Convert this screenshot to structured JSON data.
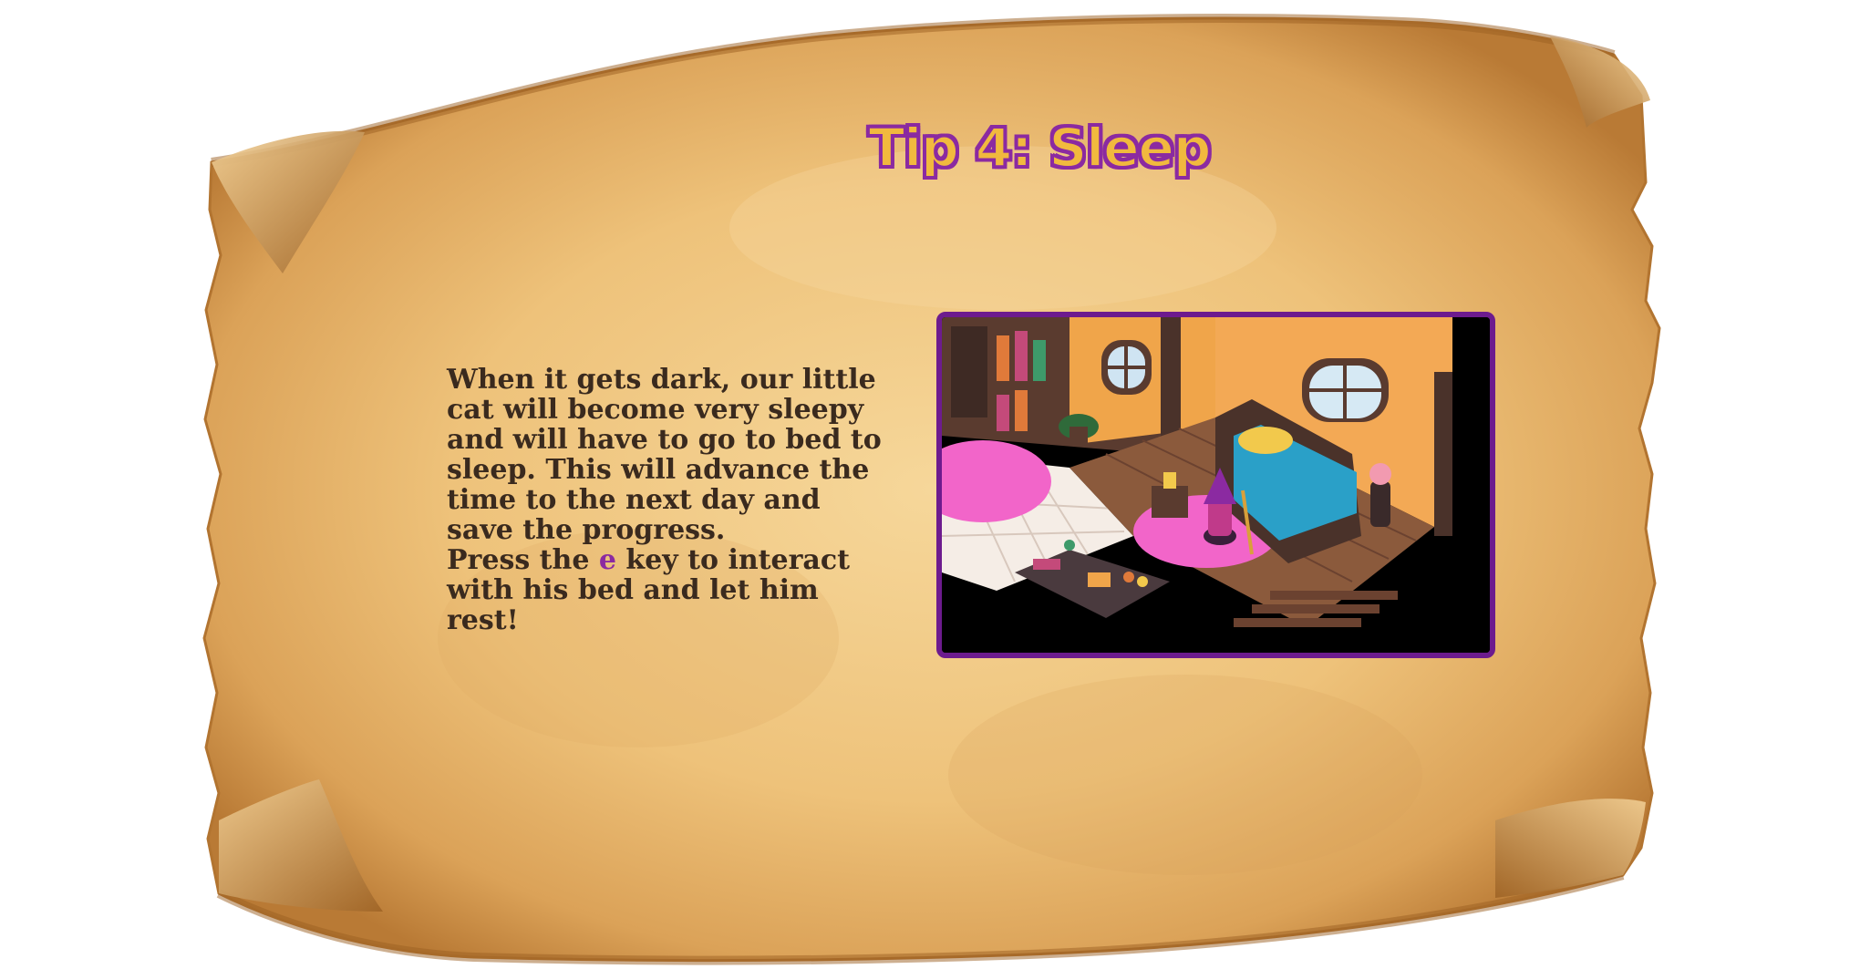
{
  "tip": {
    "title": "Tip 4:  Sleep",
    "body_part1": "When it gets dark, our little cat will become very sleepy and will have to go to bed to sleep. This will advance the time to the next day and save the progress.",
    "press_prefix": "Press the ",
    "key": "e",
    "press_suffix": " key to interact with his bed and let him rest!"
  },
  "colors": {
    "parchment": "#e8bd76",
    "parchment_edge": "#a8692a",
    "title_fill": "#f1b93e",
    "title_outline": "#8b2aa1",
    "body_text": "#3a2a1e",
    "key_highlight": "#8b2aa1",
    "frame_border": "#6d1b8e"
  },
  "image": {
    "subject": "isometric-bedroom-scene"
  }
}
